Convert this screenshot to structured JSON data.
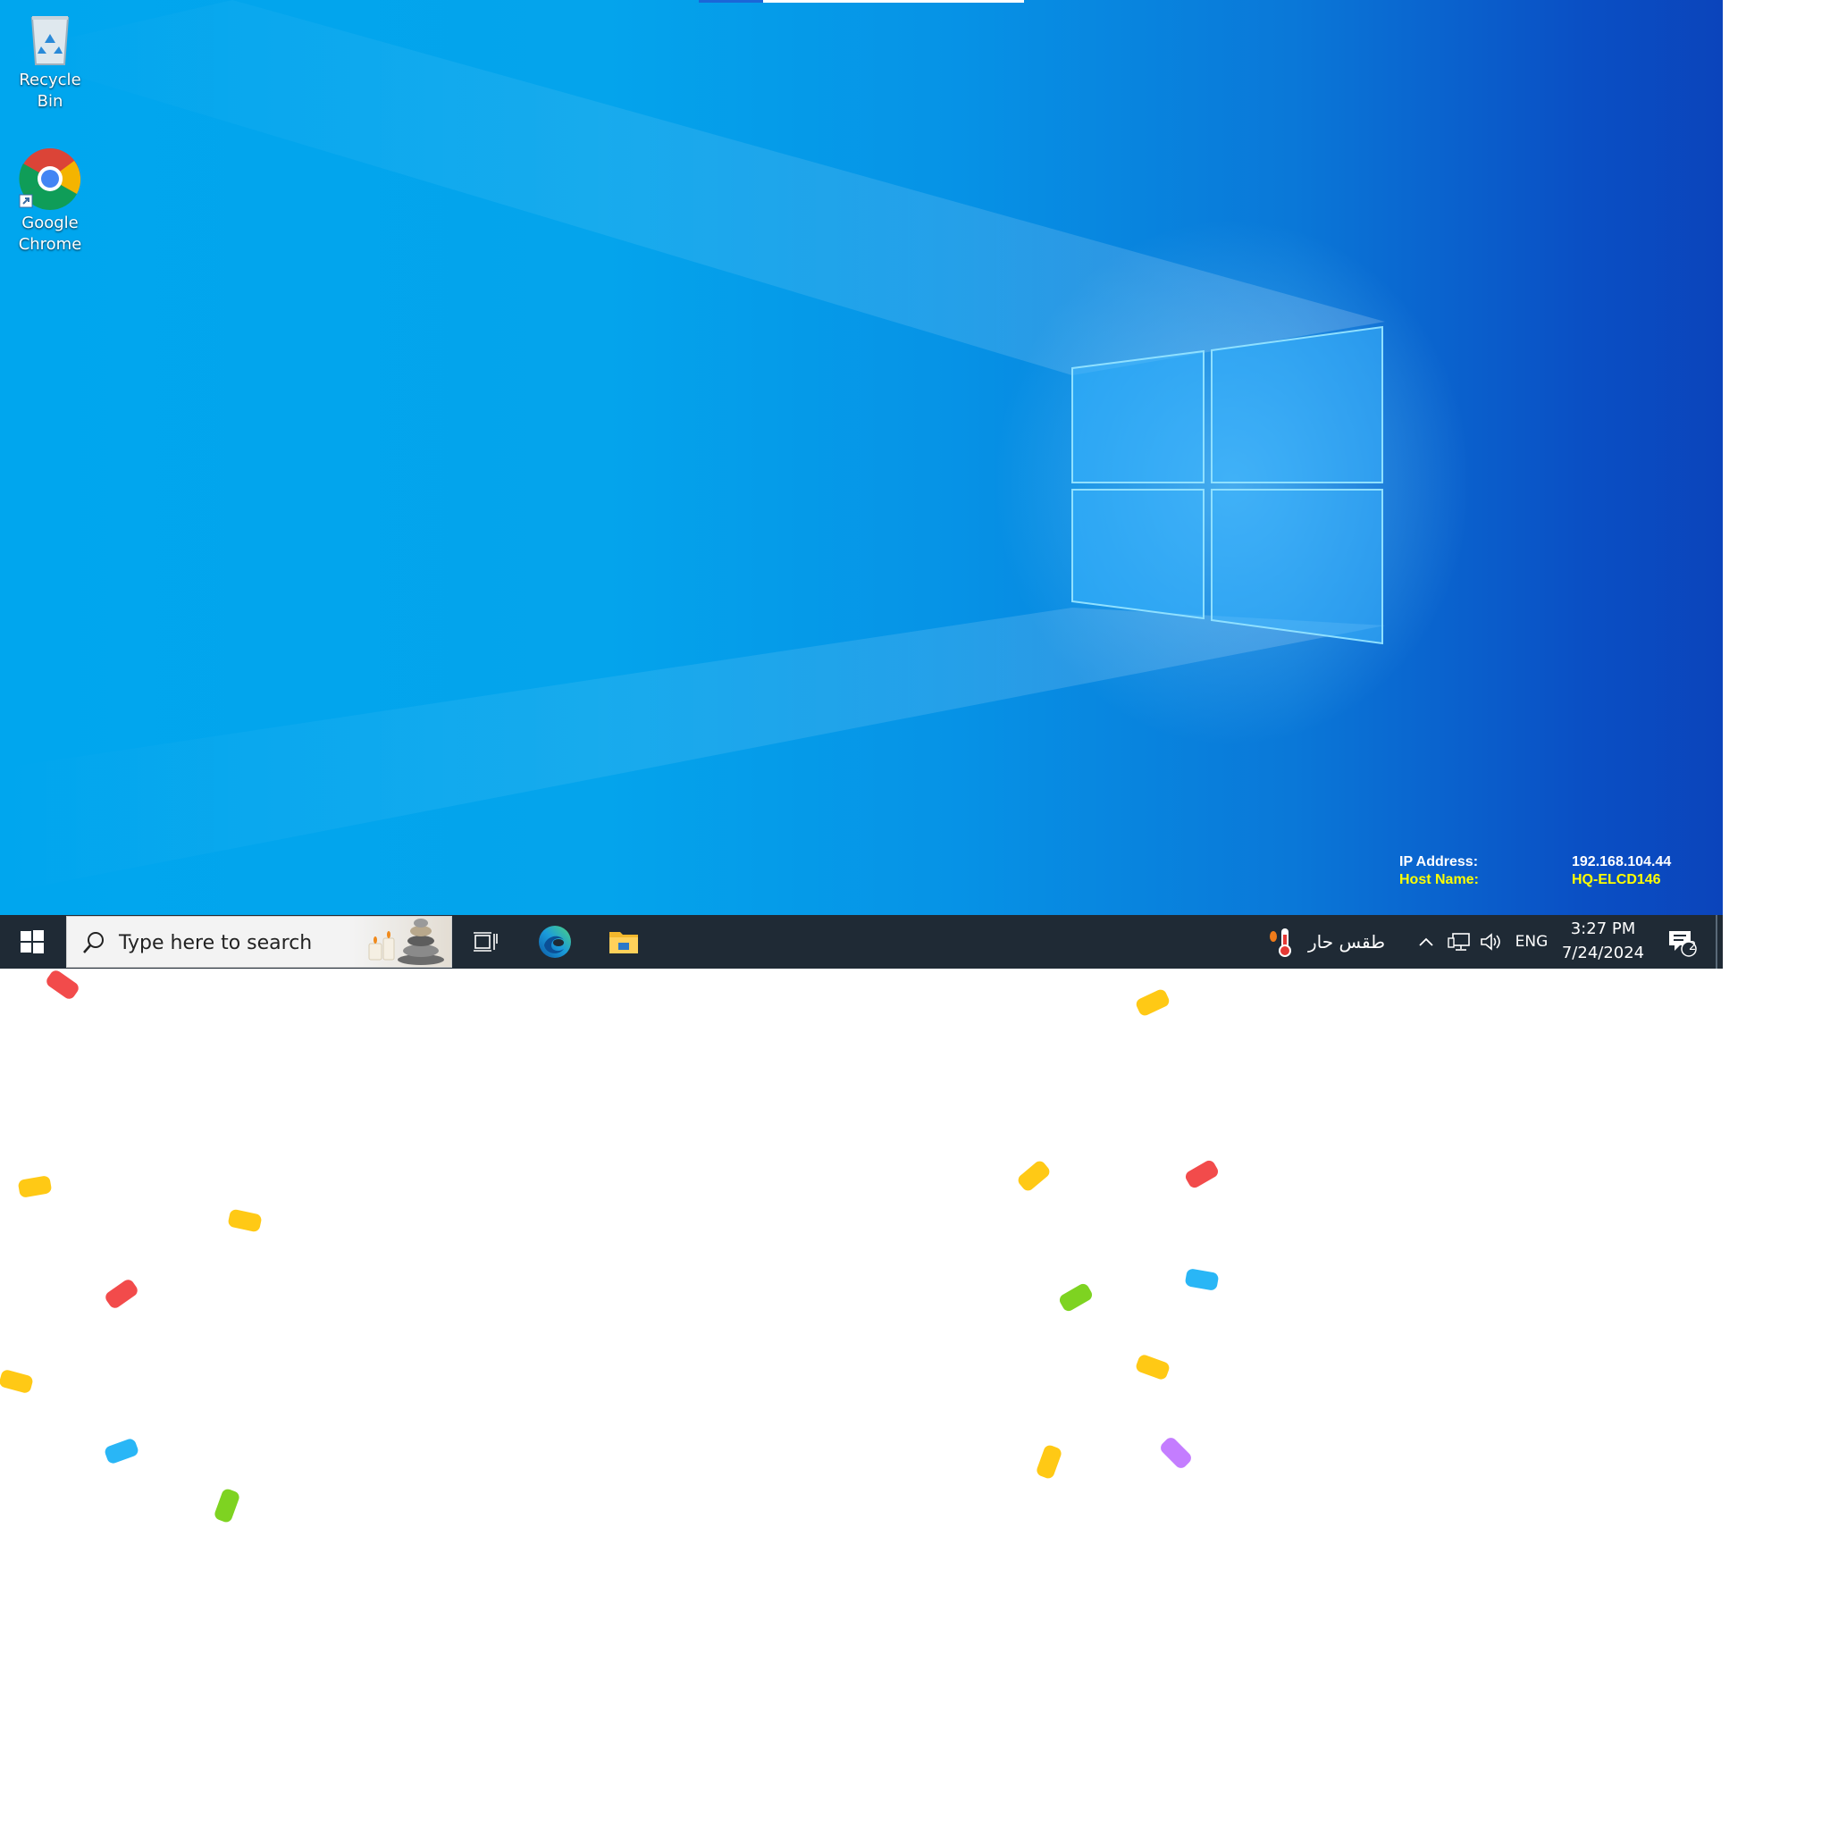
{
  "desktop": {
    "icons": [
      {
        "label": "Recycle Bin",
        "icon": "recycle-bin-icon"
      },
      {
        "label": "Google\nChrome",
        "icon": "chrome-icon"
      }
    ],
    "info_panel": {
      "ip_label": "IP Address:",
      "ip_value": "192.168.104.44",
      "host_label": "Host Name:",
      "host_value": "HQ-ELCD146",
      "colors": {
        "white": "#ffffff",
        "yellow": "#ffff00"
      }
    }
  },
  "taskbar": {
    "search_placeholder": "Type here to search",
    "pinned": [
      "task-view-icon",
      "edge-icon",
      "file-explorer-icon"
    ],
    "weather_text": "طقس حار",
    "language": "ENG",
    "time": "3:27 PM",
    "date": "7/24/2024",
    "notification_count": "2"
  },
  "colors": {
    "taskbar_bg": "#1f2a35",
    "desktop_dark": "#0b44bb",
    "desktop_light": "#00a6ee"
  }
}
